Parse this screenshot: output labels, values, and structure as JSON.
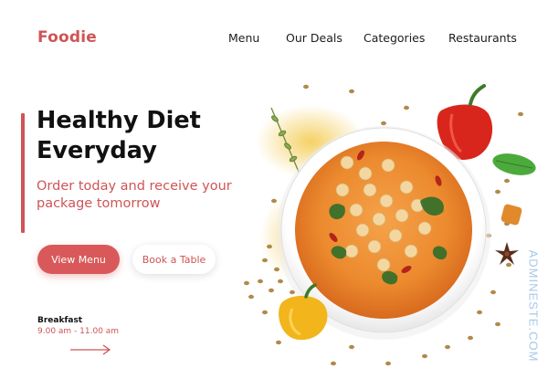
{
  "header": {
    "logo": "Foodie",
    "nav": [
      {
        "label": "Menu"
      },
      {
        "label": "Our Deals"
      },
      {
        "label": "Categories"
      },
      {
        "label": "Restaurants"
      }
    ]
  },
  "hero": {
    "headline_line1": "Healthy Diet",
    "headline_line2": "Everyday",
    "subhead": "Order today and receive your package tomorrow",
    "primary_button": "View Menu",
    "secondary_button": "Book a Table"
  },
  "hours": {
    "title": "Breakfast",
    "time": "9.00 am - 11.00 am"
  },
  "watermark": "ADMINESTE.COM",
  "colors": {
    "brand": "#cf5456",
    "text": "#111111",
    "background": "#ffffff"
  },
  "icons": {
    "arrow": "arrow-right-icon"
  }
}
